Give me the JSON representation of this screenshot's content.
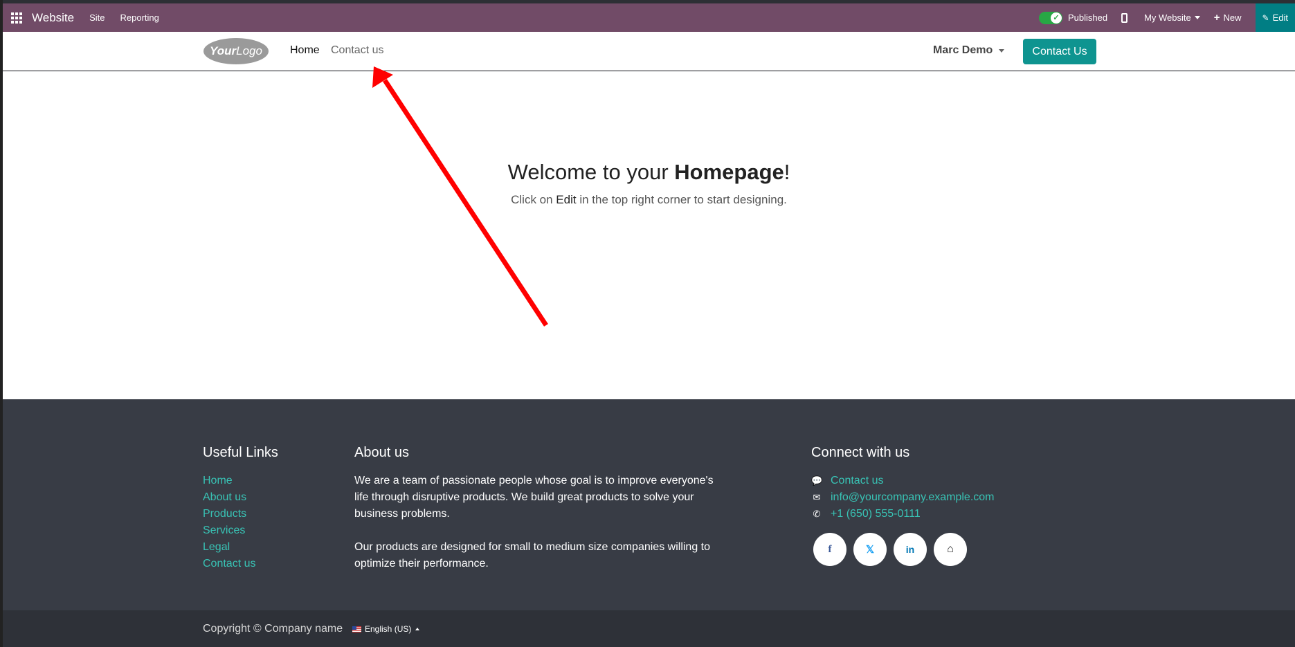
{
  "topbar": {
    "app_name": "Website",
    "menus": [
      "Site",
      "Reporting"
    ],
    "published_label": "Published",
    "website_selector": "My Website",
    "new_label": "New",
    "edit_label": "Edit",
    "bar_color": "#714b67",
    "edit_color": "#017e84"
  },
  "header": {
    "logo_text": "YourLogo",
    "nav": [
      "Home",
      "Contact us"
    ],
    "user": "Marc Demo",
    "cta_label": "Contact Us",
    "cta_color": "#0e9490"
  },
  "hero": {
    "title_prefix": "Welcome to your ",
    "title_bold": "Homepage",
    "title_suffix": "!",
    "sub_prefix": "Click on ",
    "sub_em": "Edit",
    "sub_suffix": " in the top right corner to start designing."
  },
  "annotation": {
    "arrow_color": "#ff0000"
  },
  "footer": {
    "useful_links_title": "Useful Links",
    "useful_links": [
      "Home",
      "About us",
      "Products",
      "Services",
      "Legal",
      "Contact us"
    ],
    "about_title": "About us",
    "about_p1": "We are a team of passionate people whose goal is to improve everyone's life through disruptive products. We build great products to solve your business problems.",
    "about_p2": "Our products are designed for small to medium size companies willing to optimize their performance.",
    "connect_title": "Connect with us",
    "contact_us": "Contact us",
    "email": "info@yourcompany.example.com",
    "phone": "+1 (650) 555-0111",
    "socials": [
      "facebook-icon",
      "x-icon",
      "linkedin-icon",
      "home-icon"
    ],
    "link_color": "#38c3b5"
  },
  "copyright": {
    "text": "Copyright © Company name",
    "language": "English (US)"
  }
}
